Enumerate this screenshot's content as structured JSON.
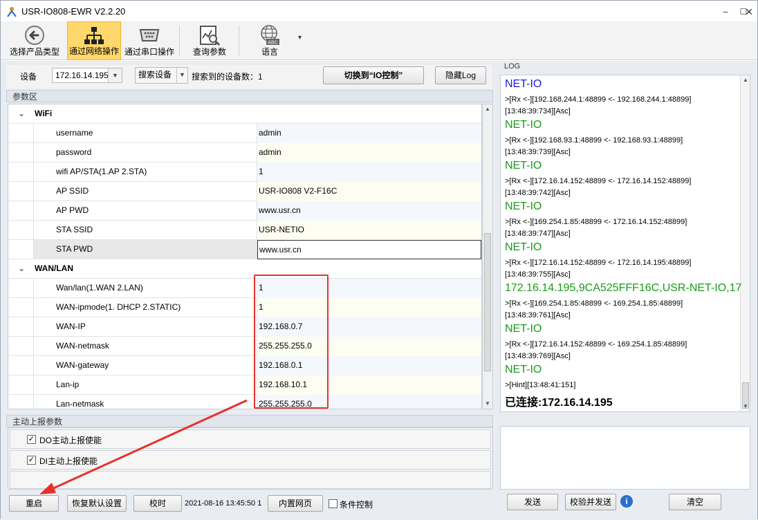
{
  "window": {
    "title": "USR-IO808-EWR V2.2.20",
    "min": "–",
    "max": "☐",
    "close": "✕"
  },
  "toolbar": {
    "items": [
      {
        "label": "选择产品类型",
        "icon": "back-arrow-icon"
      },
      {
        "label": "通过网络操作",
        "icon": "network-icon"
      },
      {
        "label": "通过串口操作",
        "icon": "serial-port-icon"
      },
      {
        "label": "查询参数",
        "icon": "search-chart-icon"
      },
      {
        "label": "语言",
        "icon": "globe-abc-icon"
      }
    ],
    "dropdown": "▾"
  },
  "device_bar": {
    "device_label": "设备",
    "device_ip": "172.16.14.195",
    "search_button": "搜索设备",
    "found_text": "搜索到的设备数：1",
    "switch_button": "切换到“IO控制”",
    "hide_log_button": "隐藏Log"
  },
  "param_area": {
    "title": "参数区",
    "groups": [
      {
        "name": "WiFi",
        "rows": [
          {
            "name": "username",
            "value": "admin"
          },
          {
            "name": "password",
            "value": "admin"
          },
          {
            "name": "wifi AP/STA(1.AP 2.STA)",
            "value": "1"
          },
          {
            "name": "AP SSID",
            "value": "USR-IO808 V2-F16C"
          },
          {
            "name": "AP PWD",
            "value": "www.usr.cn"
          },
          {
            "name": "STA SSID",
            "value": "USR-NETIO"
          },
          {
            "name": "STA PWD",
            "value": "www.usr.cn"
          }
        ]
      },
      {
        "name": "WAN/LAN",
        "rows": [
          {
            "name": "Wan/lan(1.WAN 2.LAN)",
            "value": "1"
          },
          {
            "name": "WAN-ipmode(1. DHCP 2.STATIC)",
            "value": "1"
          },
          {
            "name": "WAN-IP",
            "value": "192.168.0.7"
          },
          {
            "name": "WAN-netmask",
            "value": "255.255.255.0"
          },
          {
            "name": "WAN-gateway",
            "value": "192.168.0.1"
          },
          {
            "name": "Lan-ip",
            "value": "192.168.10.1"
          },
          {
            "name": "Lan-netmask",
            "value": "255.255.255.0"
          }
        ]
      }
    ]
  },
  "auto_report": {
    "title": "主动上报参数",
    "do_label": "DO主动上报使能",
    "di_label": "DI主动上报使能"
  },
  "bottom_bar": {
    "restart": "重启",
    "restore": "恢复默认设置",
    "sync_time": "校时",
    "datetime": "2021-08-16 13:45:50 1",
    "web": "内置网页",
    "condition": "条件控制"
  },
  "log": {
    "title": "LOG",
    "lines": [
      {
        "text": "NET-IO",
        "style": "big",
        "color": "#1a1adc"
      },
      {
        "text": ">[Rx <-][192.168.244.1:48899 <- 192.168.244.1:48899]",
        "style": "small",
        "color": "#000000"
      },
      {
        "text": "[13:48:39:734][Asc]",
        "style": "small",
        "color": "#000000"
      },
      {
        "text": "NET-IO",
        "style": "big",
        "color": "#1a9a1a"
      },
      {
        "text": ">[Rx <-][192.168.93.1:48899 <- 192.168.93.1:48899]",
        "style": "small",
        "color": "#000000"
      },
      {
        "text": "[13:48:39:739][Asc]",
        "style": "small",
        "color": "#000000"
      },
      {
        "text": "NET-IO",
        "style": "big",
        "color": "#1a9a1a"
      },
      {
        "text": ">[Rx <-][172.16.14.152:48899 <- 172.16.14.152:48899]",
        "style": "small",
        "color": "#000000"
      },
      {
        "text": "[13:48:39:742][Asc]",
        "style": "small",
        "color": "#000000"
      },
      {
        "text": "NET-IO",
        "style": "big",
        "color": "#1a9a1a"
      },
      {
        "text": ">[Rx <-][169.254.1.85:48899 <- 172.16.14.152:48899]",
        "style": "small",
        "color": "#000000"
      },
      {
        "text": "[13:48:39:747][Asc]",
        "style": "small",
        "color": "#000000"
      },
      {
        "text": "NET-IO",
        "style": "big",
        "color": "#1a9a1a"
      },
      {
        "text": ">[Rx <-][172.16.14.152:48899 <- 172.16.14.195:48899]",
        "style": "small",
        "color": "#000000"
      },
      {
        "text": "[13:48:39:755][Asc]",
        "style": "small",
        "color": "#000000"
      },
      {
        "text": "172.16.14.195,9CA525FFF16C,USR-NET-IO,17",
        "style": "big",
        "color": "#1a9a1a"
      },
      {
        "text": ">[Rx <-][169.254.1.85:48899 <- 169.254.1.85:48899]",
        "style": "small",
        "color": "#000000"
      },
      {
        "text": "[13:48:39:761][Asc]",
        "style": "small",
        "color": "#000000"
      },
      {
        "text": "NET-IO",
        "style": "big",
        "color": "#1a9a1a"
      },
      {
        "text": ">[Rx <-][172.16.14.152:48899 <- 169.254.1.85:48899]",
        "style": "small",
        "color": "#000000"
      },
      {
        "text": "[13:48:39:769][Asc]",
        "style": "small",
        "color": "#000000"
      },
      {
        "text": "NET-IO",
        "style": "big",
        "color": "#1a9a1a"
      },
      {
        "text": ">[Hint][13:48:41:151]",
        "style": "small",
        "color": "#000000"
      },
      {
        "text": "已连接:172.16.14.195",
        "style": "bold",
        "color": "#000000"
      }
    ],
    "send": "发送",
    "checksum_send": "校验并发送",
    "clear": "清空"
  },
  "colors": {
    "highlight": "#e8302a",
    "active_tool": "#ffd76a"
  }
}
